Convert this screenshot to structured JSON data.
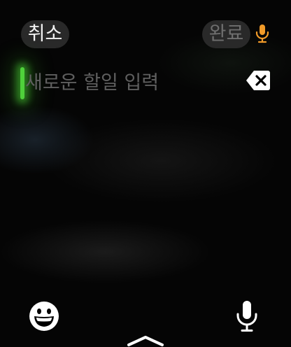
{
  "header": {
    "cancel_label": "취소",
    "done_label": "완료"
  },
  "input": {
    "placeholder": "새로운 할일 입력",
    "value": ""
  },
  "icons": {
    "dictation_small": "microphone-icon",
    "delete": "delete-backspace-icon",
    "emoji": "emoji-smiley-icon",
    "dictation": "microphone-icon",
    "more": "chevron-up-icon"
  },
  "colors": {
    "cursor": "#4fd13b",
    "dictation_accent": "#f19a28",
    "pill_background": "#2d2d2d",
    "done_text_disabled": "#6f6f6f",
    "placeholder_text": "#5f5f5f"
  }
}
